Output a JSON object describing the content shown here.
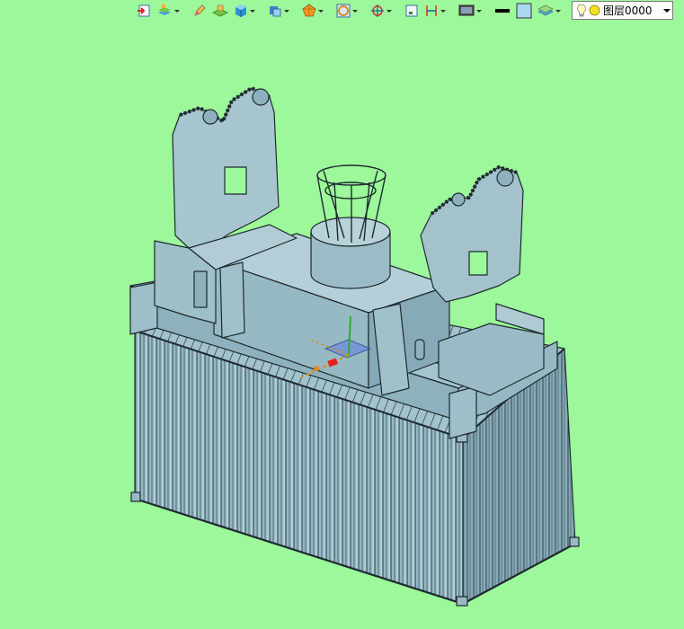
{
  "toolbar": {
    "items": [
      {
        "icon": "import-icon"
      },
      {
        "icon": "layers-stack-icon"
      },
      {
        "icon": "pencil-icon"
      },
      {
        "icon": "plane-icon"
      },
      {
        "icon": "cube-icon"
      },
      {
        "icon": "box-view-icon"
      },
      {
        "icon": "polygon-icon"
      },
      {
        "icon": "circle-frame-icon"
      },
      {
        "icon": "target-icon"
      },
      {
        "icon": "frame-icon"
      },
      {
        "icon": "dimension-icon"
      },
      {
        "icon": "monitor-icon"
      },
      {
        "icon": "line-weight-icon"
      },
      {
        "icon": "color-swatch-icon"
      },
      {
        "icon": "layer-icon"
      }
    ],
    "layer_name": "图层0000",
    "colors": {
      "line": "#000000",
      "swatch": "#a8d8f0"
    }
  },
  "scene": {
    "background": "#9cf89a",
    "model_color": "#8fb4c0",
    "edge_color": "#1e2a30"
  }
}
